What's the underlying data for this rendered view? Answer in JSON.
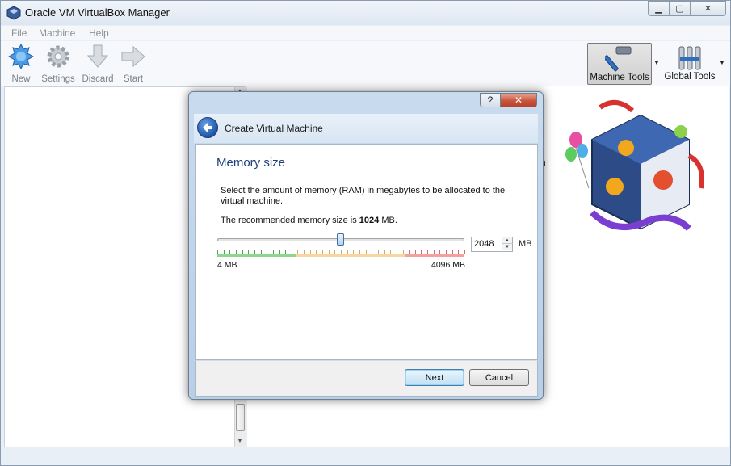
{
  "window": {
    "title": "Oracle VM VirtualBox Manager",
    "controls": {
      "minimize": "▁",
      "maximize": "▢",
      "close": "✕"
    }
  },
  "menu": {
    "file": "File",
    "machine": "Machine",
    "help": "Help"
  },
  "toolbar": {
    "new": "New",
    "settings": "Settings",
    "discard": "Discard",
    "start": "Start",
    "machine_tools": "Machine Tools",
    "global_tools": "Global Tools"
  },
  "background_text": {
    "right_pane_partial": "n"
  },
  "dialog": {
    "controls": {
      "help": "?",
      "close": "✕"
    },
    "title": "Create Virtual Machine",
    "section_title": "Memory size",
    "description": "Select the amount of memory (RAM) in megabytes to be allocated to the virtual machine.",
    "recommend_prefix": "The recommended memory size is ",
    "recommend_value": "1024",
    "recommend_suffix": " MB.",
    "memory": {
      "value": "2048",
      "unit": "MB",
      "min_label": "4 MB",
      "max_label": "4096 MB",
      "min": 4,
      "max": 4096,
      "current": 2048,
      "green_until": 1300,
      "red_from": 3100
    },
    "buttons": {
      "next": "Next",
      "cancel": "Cancel"
    }
  },
  "colors": {
    "accent": "#1e3f78",
    "green_zone": "#8fd48f",
    "red_zone": "#f2a0a0",
    "close_red": "#c8553c"
  }
}
